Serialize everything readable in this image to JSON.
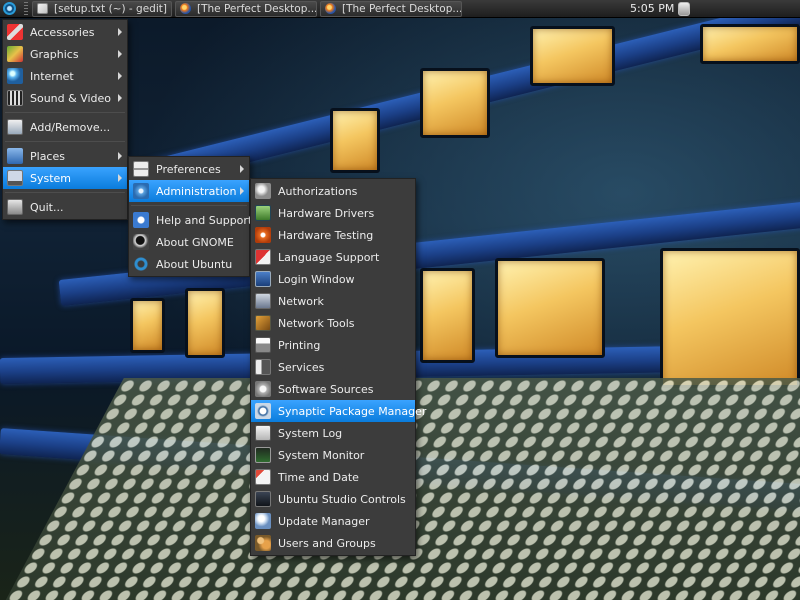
{
  "panel": {
    "tasks": [
      {
        "label": "[setup.txt (~) - gedit]",
        "icon": "gedit-icon"
      },
      {
        "label": "[The Perfect Desktop...",
        "icon": "firefox-icon"
      },
      {
        "label": "[The Perfect Desktop...",
        "icon": "firefox-icon"
      }
    ],
    "clock": "5:05 PM"
  },
  "main_menu": {
    "items": [
      {
        "label": "Accessories",
        "icon": "accessories-icon",
        "submenu": true
      },
      {
        "label": "Graphics",
        "icon": "graphics-icon",
        "submenu": true
      },
      {
        "label": "Internet",
        "icon": "internet-icon",
        "submenu": true
      },
      {
        "label": "Sound & Video",
        "icon": "sound-video-icon",
        "submenu": true
      },
      {
        "label": "Add/Remove...",
        "icon": "add-remove-icon",
        "submenu": false
      },
      {
        "label": "Places",
        "icon": "places-icon",
        "submenu": true
      },
      {
        "label": "System",
        "icon": "system-icon",
        "submenu": true,
        "active": true
      },
      {
        "label": "Quit...",
        "icon": "quit-icon",
        "submenu": false
      }
    ]
  },
  "system_menu": {
    "items": [
      {
        "label": "Preferences",
        "icon": "preferences-icon",
        "submenu": true
      },
      {
        "label": "Administration",
        "icon": "administration-icon",
        "submenu": true,
        "active": true
      },
      {
        "label": "Help and Support",
        "icon": "help-icon",
        "submenu": false
      },
      {
        "label": "About GNOME",
        "icon": "gnome-icon",
        "submenu": false
      },
      {
        "label": "About Ubuntu",
        "icon": "ubuntu-icon",
        "submenu": false
      }
    ]
  },
  "admin_menu": {
    "items": [
      {
        "label": "Authorizations",
        "icon": "authorizations-icon"
      },
      {
        "label": "Hardware Drivers",
        "icon": "hardware-drivers-icon"
      },
      {
        "label": "Hardware Testing",
        "icon": "hardware-testing-icon"
      },
      {
        "label": "Language Support",
        "icon": "language-support-icon"
      },
      {
        "label": "Login Window",
        "icon": "login-window-icon"
      },
      {
        "label": "Network",
        "icon": "network-icon"
      },
      {
        "label": "Network Tools",
        "icon": "network-tools-icon"
      },
      {
        "label": "Printing",
        "icon": "printing-icon"
      },
      {
        "label": "Services",
        "icon": "services-icon"
      },
      {
        "label": "Software Sources",
        "icon": "software-sources-icon"
      },
      {
        "label": "Synaptic Package Manager",
        "icon": "synaptic-icon",
        "active": true
      },
      {
        "label": "System Log",
        "icon": "system-log-icon"
      },
      {
        "label": "System Monitor",
        "icon": "system-monitor-icon"
      },
      {
        "label": "Time and Date",
        "icon": "time-date-icon"
      },
      {
        "label": "Ubuntu Studio Controls",
        "icon": "studio-controls-icon"
      },
      {
        "label": "Update Manager",
        "icon": "update-manager-icon"
      },
      {
        "label": "Users and Groups",
        "icon": "users-groups-icon"
      }
    ]
  },
  "colors": {
    "menu_bg": "#3c3c3c",
    "highlight": "#1a8cf0",
    "panel_bg": "#262626"
  }
}
